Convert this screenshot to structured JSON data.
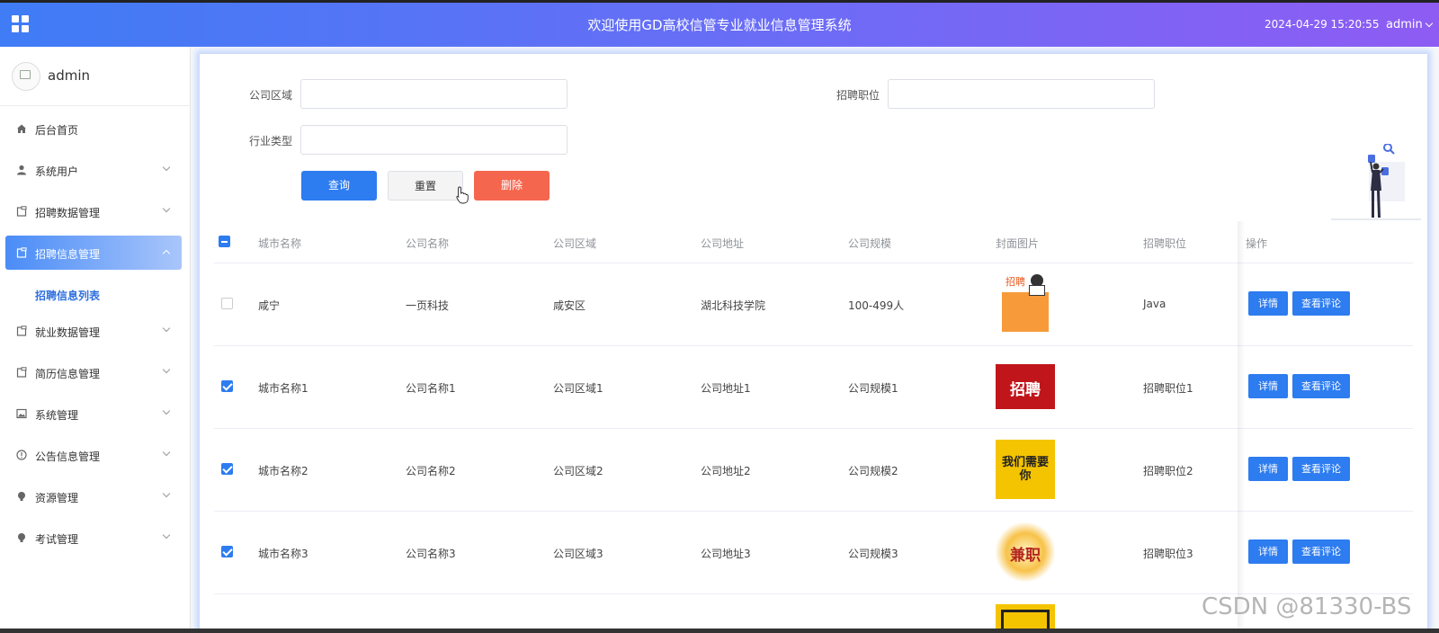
{
  "header": {
    "title": "欢迎使用GD高校信管专业就业信息管理系统",
    "datetime": "2024-04-29 15:20:55",
    "user": "admin"
  },
  "sidebar": {
    "profile_name": "admin",
    "items": [
      {
        "label": "后台首页",
        "icon": "home-icon"
      },
      {
        "label": "系统用户",
        "icon": "user-icon"
      },
      {
        "label": "招聘数据管理",
        "icon": "clipboard-icon"
      },
      {
        "label": "招聘信息管理",
        "icon": "clipboard-icon"
      },
      {
        "label": "就业数据管理",
        "icon": "clipboard-icon"
      },
      {
        "label": "简历信息管理",
        "icon": "clipboard-icon"
      },
      {
        "label": "系统管理",
        "icon": "image-icon"
      },
      {
        "label": "公告信息管理",
        "icon": "info-icon"
      },
      {
        "label": "资源管理",
        "icon": "bulb-icon"
      },
      {
        "label": "考试管理",
        "icon": "bulb-icon"
      }
    ],
    "submenu_label": "招聘信息列表"
  },
  "filters": {
    "area_label": "公司区域",
    "area_value": "",
    "position_label": "招聘职位",
    "position_value": "",
    "industry_label": "行业类型",
    "industry_value": ""
  },
  "buttons": {
    "query": "查询",
    "reset": "重置",
    "delete": "删除"
  },
  "table": {
    "headers": [
      "城市名称",
      "公司名称",
      "公司区域",
      "公司地址",
      "公司规模",
      "封面图片",
      "招聘职位",
      "操作"
    ],
    "rows": [
      {
        "checked": false,
        "city": "咸宁",
        "company": "一页科技",
        "area": "咸安区",
        "address": "湖北科技学院",
        "scale": "100-499人",
        "cover_text": "招聘",
        "position": "Java"
      },
      {
        "checked": true,
        "city": "城市名称1",
        "company": "公司名称1",
        "area": "公司区域1",
        "address": "公司地址1",
        "scale": "公司规模1",
        "cover_text": "招聘",
        "position": "招聘职位1"
      },
      {
        "checked": true,
        "city": "城市名称2",
        "company": "公司名称2",
        "area": "公司区域2",
        "address": "公司地址2",
        "scale": "公司规模2",
        "cover_text": "我们需要你",
        "position": "招聘职位2"
      },
      {
        "checked": true,
        "city": "城市名称3",
        "company": "公司名称3",
        "area": "公司区域3",
        "address": "公司地址3",
        "scale": "公司规模3",
        "cover_text": "兼职",
        "position": "招聘职位3"
      }
    ],
    "detail_label": "详情",
    "review_label": "查看评论"
  },
  "watermark": "CSDN @81330-BS",
  "colors": {
    "primary": "#2d7cf0",
    "danger": "#f5664e",
    "header_start": "#3f7cf5",
    "header_end": "#8e5cf3"
  }
}
